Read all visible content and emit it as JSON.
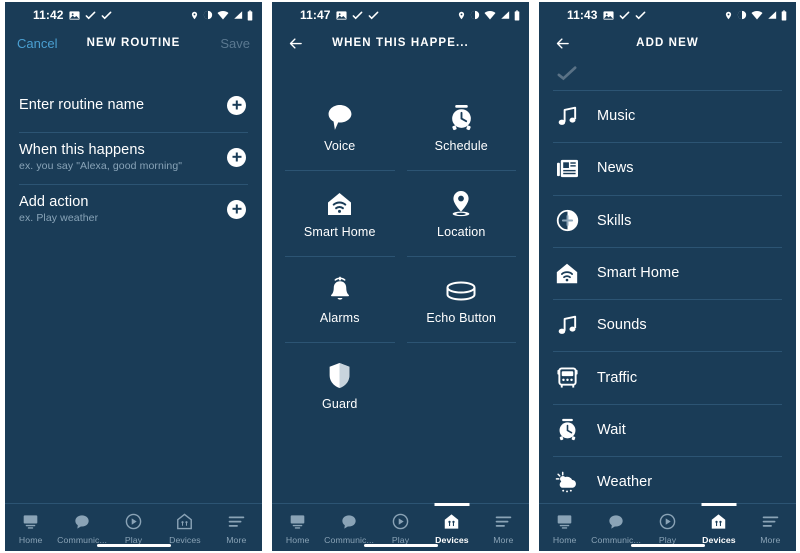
{
  "theme": {
    "bg": "#1a3c57",
    "divider": "#2c5473",
    "text": "#ffffff",
    "muted": "#89a4b8",
    "accent": "#4a9fd1",
    "disabled": "#5a7890"
  },
  "panels": [
    {
      "id": "new-routine",
      "statusbar": {
        "time": "11:42",
        "left_icons": [
          "image-icon",
          "check-icon",
          "check-icon"
        ],
        "right_icons": [
          "location-pin-icon",
          "dnd-icon",
          "wifi-icon",
          "signal-icon",
          "battery-icon"
        ]
      },
      "header": {
        "type": "cancel-save",
        "cancel_label": "Cancel",
        "title": "NEW ROUTINE",
        "save_label": "Save",
        "save_enabled": false
      },
      "rows": [
        {
          "title": "Enter routine name",
          "subtitle": "",
          "action_icon": "plus-icon"
        },
        {
          "title": "When this happens",
          "subtitle": "ex. you say \"Alexa, good morning\"",
          "action_icon": "plus-icon"
        },
        {
          "title": "Add action",
          "subtitle": "ex. Play weather",
          "action_icon": "plus-icon"
        }
      ],
      "tabbar": {
        "active": null,
        "items": [
          {
            "label": "Home",
            "icon": "home-icon"
          },
          {
            "label": "Communic...",
            "icon": "speech-bubble-icon"
          },
          {
            "label": "Play",
            "icon": "play-circle-icon"
          },
          {
            "label": "Devices",
            "icon": "devices-house-icon"
          },
          {
            "label": "More",
            "icon": "hamburger-icon"
          }
        ]
      }
    },
    {
      "id": "when-this-happens",
      "statusbar": {
        "time": "11:47",
        "left_icons": [
          "image-icon",
          "check-icon",
          "check-icon"
        ],
        "right_icons": [
          "location-pin-icon",
          "dnd-icon",
          "wifi-icon",
          "signal-icon",
          "battery-icon"
        ]
      },
      "header": {
        "type": "back",
        "back_icon": "arrow-left-icon",
        "title": "WHEN THIS HAPPE..."
      },
      "grid": [
        {
          "label": "Voice",
          "icon": "speech-bubble-icon"
        },
        {
          "label": "Schedule",
          "icon": "alarm-clock-icon"
        },
        {
          "label": "Smart Home",
          "icon": "smart-home-icon"
        },
        {
          "label": "Location",
          "icon": "location-pin-icon"
        },
        {
          "label": "Alarms",
          "icon": "bell-icon"
        },
        {
          "label": "Echo Button",
          "icon": "echo-button-icon"
        },
        {
          "label": "Guard",
          "icon": "shield-icon"
        }
      ],
      "tabbar": {
        "active": "Devices",
        "items": [
          {
            "label": "Home",
            "icon": "home-icon"
          },
          {
            "label": "Communic...",
            "icon": "speech-bubble-icon"
          },
          {
            "label": "Play",
            "icon": "play-circle-icon"
          },
          {
            "label": "Devices",
            "icon": "devices-house-icon"
          },
          {
            "label": "More",
            "icon": "hamburger-icon"
          }
        ]
      }
    },
    {
      "id": "add-new",
      "statusbar": {
        "time": "11:43",
        "left_icons": [
          "image-icon",
          "check-icon",
          "check-icon"
        ],
        "right_icons": [
          "location-pin-icon",
          "dnd-icon",
          "wifi-icon",
          "signal-icon",
          "battery-icon"
        ]
      },
      "header": {
        "type": "back",
        "back_icon": "arrow-left-icon",
        "title": "ADD NEW"
      },
      "list": [
        {
          "label": "Music",
          "icon": "music-note-icon"
        },
        {
          "label": "News",
          "icon": "news-icon"
        },
        {
          "label": "Skills",
          "icon": "skills-plus-icon"
        },
        {
          "label": "Smart Home",
          "icon": "smart-home-icon"
        },
        {
          "label": "Sounds",
          "icon": "music-note-icon"
        },
        {
          "label": "Traffic",
          "icon": "bus-icon"
        },
        {
          "label": "Wait",
          "icon": "alarm-clock-icon"
        },
        {
          "label": "Weather",
          "icon": "weather-icon"
        }
      ],
      "tabbar": {
        "active": "Devices",
        "items": [
          {
            "label": "Home",
            "icon": "home-icon"
          },
          {
            "label": "Communic...",
            "icon": "speech-bubble-icon"
          },
          {
            "label": "Play",
            "icon": "play-circle-icon"
          },
          {
            "label": "Devices",
            "icon": "devices-house-icon"
          },
          {
            "label": "More",
            "icon": "hamburger-icon"
          }
        ]
      }
    }
  ]
}
